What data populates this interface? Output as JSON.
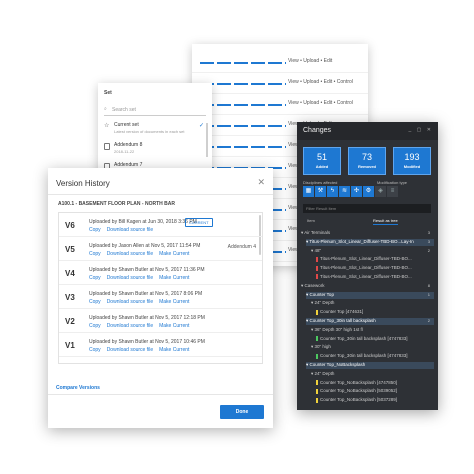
{
  "permissions": {
    "rows": [
      "View • Upload • Edit",
      "View • Upload • Edit • Control",
      "View • Upload • Edit • Control",
      "View • Upload • Edit",
      "View • Upload • Edit • Control",
      "View • Upload • Edit • Control",
      "View • Upload • Edit • Control",
      "View • Upload • Edit • Control",
      "View • Upload • Edit • Control",
      "View • Upload • Edit • Control"
    ]
  },
  "set_panel": {
    "title": "Set",
    "search_placeholder": "Search set",
    "current": {
      "name": "Current set",
      "sub": "Latest version of documents in each set"
    },
    "items": [
      {
        "name": "Addendum 8",
        "sub": "2018-11-22"
      },
      {
        "name": "Addendum 7",
        "sub": "2018-10-12"
      }
    ]
  },
  "version_history": {
    "title": "Version History",
    "sheet": "A100.1 - BASEMENT FLOOR PLAN - NORTH BAR",
    "copy_label": "Copy",
    "download_label": "Download source file",
    "make_current_label": "Make Current",
    "current_badge": "CURRENT",
    "versions": [
      {
        "ver": "V6",
        "uploaded": "Uploaded by Bill Kagen at Jun 30, 2018 3:36 PM",
        "addendum": ""
      },
      {
        "ver": "V5",
        "uploaded": "Uploaded by Jason Allen at Nov 5, 2017 11:54 PM",
        "addendum": "Addendum 4"
      },
      {
        "ver": "V4",
        "uploaded": "Uploaded by Shawn Butler at Nov 5, 2017 11:36 PM",
        "addendum": ""
      },
      {
        "ver": "V3",
        "uploaded": "Uploaded by Shawn Butler at Nov 5, 2017 8:06 PM",
        "addendum": ""
      },
      {
        "ver": "V2",
        "uploaded": "Uploaded by Shawn Butler at Nov 5, 2017 12:18 PM",
        "addendum": ""
      },
      {
        "ver": "V1",
        "uploaded": "Uploaded by Shawn Butler at Nov 5, 2017 10:46 PM",
        "addendum": ""
      }
    ],
    "compare_label": "Compare Versions",
    "done_label": "Done"
  },
  "changes": {
    "title": "Changes",
    "window_buttons": "_ ▢ ✕",
    "tiles": [
      {
        "num": "51",
        "label": "Added"
      },
      {
        "num": "73",
        "label": "Removed"
      },
      {
        "num": "193",
        "label": "Modified"
      }
    ],
    "disciplines_label": "Disciplines affected",
    "modification_label": "Modification type",
    "filter_placeholder": "Filter Result Item",
    "tab_a": "Item",
    "tab_b": "Result as tree",
    "tree": [
      {
        "text": "▾ Air Terminals",
        "mark": "",
        "count": "3",
        "indent": 0,
        "sel": false
      },
      {
        "text": "▾ Titus-Plenum_Slot_Linear_Diffuser-TBD-BO...Lay-In",
        "mark": "",
        "count": "3",
        "indent": 1,
        "sel": true
      },
      {
        "text": "▾ 48\"",
        "mark": "",
        "count": "2",
        "indent": 2,
        "sel": false
      },
      {
        "text": "Titus-Plenum_Slot_Linear_Diffuser-TBD-BO...",
        "mark": "red",
        "count": "",
        "indent": 3,
        "sel": false
      },
      {
        "text": "Titus-Plenum_Slot_Linear_Diffuser-TBD-BO...",
        "mark": "red",
        "count": "",
        "indent": 3,
        "sel": false
      },
      {
        "text": "Titus-Plenum_Slot_Linear_Diffuser-TBD-BO...",
        "mark": "red",
        "count": "",
        "indent": 3,
        "sel": false
      },
      {
        "text": "▾ Casework",
        "mark": "",
        "count": "8",
        "indent": 0,
        "sel": false
      },
      {
        "text": "▾ Counter Top",
        "mark": "",
        "count": "1",
        "indent": 1,
        "sel": true
      },
      {
        "text": "▾ 24\" Depth",
        "mark": "",
        "count": "",
        "indent": 2,
        "sel": false
      },
      {
        "text": "Counter Top [474631]",
        "mark": "yellow",
        "count": "",
        "indent": 3,
        "sel": false
      },
      {
        "text": "▾ Counter Top_30in tall backsplash",
        "mark": "",
        "count": "2",
        "indent": 1,
        "sel": true
      },
      {
        "text": "▾ 36\" Depth 30\" high 1st fl",
        "mark": "",
        "count": "",
        "indent": 2,
        "sel": false
      },
      {
        "text": "Counter Top_30in tall backsplash [4747833]",
        "mark": "green",
        "count": "",
        "indent": 3,
        "sel": false
      },
      {
        "text": "▾ 30\" high",
        "mark": "",
        "count": "",
        "indent": 2,
        "sel": false
      },
      {
        "text": "Counter Top_30in tall backsplash [4747833]",
        "mark": "green",
        "count": "",
        "indent": 3,
        "sel": false
      },
      {
        "text": "▾ Counter Top_NoBacksplash",
        "mark": "",
        "count": "",
        "indent": 1,
        "sel": true
      },
      {
        "text": "▾ 24\" Depth",
        "mark": "",
        "count": "",
        "indent": 2,
        "sel": false
      },
      {
        "text": "Counter Top_NoBacksplash [4747850]",
        "mark": "yellow",
        "count": "",
        "indent": 3,
        "sel": false
      },
      {
        "text": "Counter Top_NoBacksplash [5039052]",
        "mark": "yellow",
        "count": "",
        "indent": 3,
        "sel": false
      },
      {
        "text": "Counter Top_NoBacksplash [5037289]",
        "mark": "yellow",
        "count": "",
        "indent": 3,
        "sel": false
      }
    ]
  }
}
